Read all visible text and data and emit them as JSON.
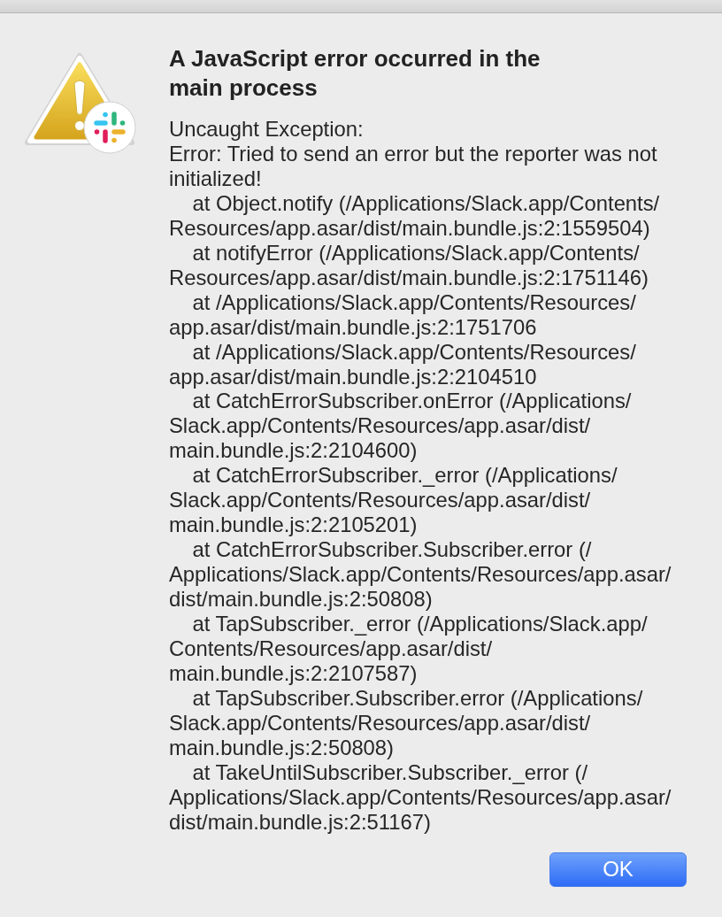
{
  "dialog": {
    "title": "A JavaScript error occurred in the main process",
    "message_lines": [
      "Uncaught Exception:",
      "Error: Tried to send an error but the reporter was not",
      "initialized!",
      "    at Object.notify (/Applications/Slack.app/Contents/",
      "Resources/app.asar/dist/main.bundle.js:2:1559504)",
      "    at notifyError (/Applications/Slack.app/Contents/",
      "Resources/app.asar/dist/main.bundle.js:2:1751146)",
      "    at /Applications/Slack.app/Contents/Resources/",
      "app.asar/dist/main.bundle.js:2:1751706",
      "    at /Applications/Slack.app/Contents/Resources/",
      "app.asar/dist/main.bundle.js:2:2104510",
      "    at CatchErrorSubscriber.onError (/Applications/",
      "Slack.app/Contents/Resources/app.asar/dist/",
      "main.bundle.js:2:2104600)",
      "    at CatchErrorSubscriber._error (/Applications/",
      "Slack.app/Contents/Resources/app.asar/dist/",
      "main.bundle.js:2:2105201)",
      "    at CatchErrorSubscriber.Subscriber.error (/",
      "Applications/Slack.app/Contents/Resources/app.asar/",
      "dist/main.bundle.js:2:50808)",
      "    at TapSubscriber._error (/Applications/Slack.app/",
      "Contents/Resources/app.asar/dist/",
      "main.bundle.js:2:2107587)",
      "    at TapSubscriber.Subscriber.error (/Applications/",
      "Slack.app/Contents/Resources/app.asar/dist/",
      "main.bundle.js:2:50808)",
      "    at TakeUntilSubscriber.Subscriber._error (/",
      "Applications/Slack.app/Contents/Resources/app.asar/",
      "dist/main.bundle.js:2:51167)"
    ],
    "buttons": [
      {
        "label": "OK",
        "default": true
      }
    ]
  }
}
